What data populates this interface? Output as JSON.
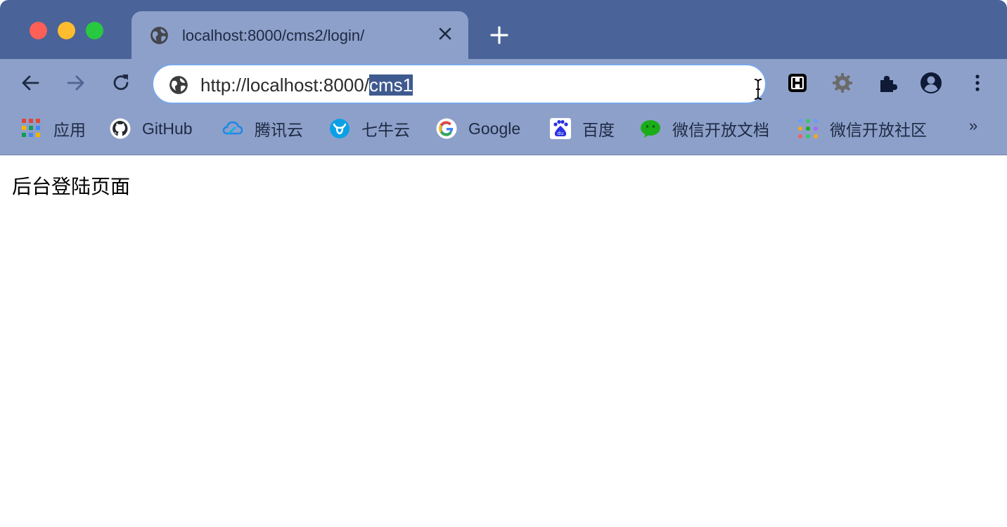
{
  "tab": {
    "title": "localhost:8000/cms2/login/"
  },
  "address_bar": {
    "url_prefix": "http://localhost:8000/",
    "url_selected": "cms1"
  },
  "bookmarks": [
    {
      "label": "应用",
      "icon": "apps-grid-icon"
    },
    {
      "label": "GitHub",
      "icon": "github-icon"
    },
    {
      "label": "腾讯云",
      "icon": "tencent-cloud-icon"
    },
    {
      "label": "七牛云",
      "icon": "qiniu-icon"
    },
    {
      "label": "Google",
      "icon": "google-icon"
    },
    {
      "label": "百度",
      "icon": "baidu-icon"
    },
    {
      "label": "微信开放文档",
      "icon": "wechat-icon"
    },
    {
      "label": "微信开放社区",
      "icon": "wechat-community-icon"
    }
  ],
  "bookmarks_overflow": "»",
  "page": {
    "heading": "后台登陆页面"
  },
  "colors": {
    "tabstrip": "#4a6499",
    "toolbar": "#8da0c9",
    "selection": "#3f5a8f",
    "omnibox_border": "#79a7e8"
  }
}
